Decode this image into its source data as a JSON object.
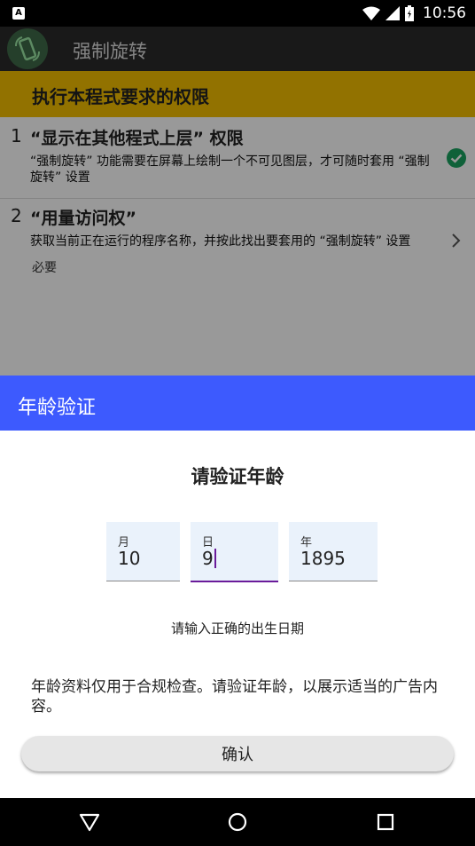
{
  "status_bar": {
    "notification_icon": "A",
    "time": "10:56",
    "icons": [
      "wifi-icon",
      "signal-icon",
      "battery-icon"
    ]
  },
  "app": {
    "title": "强制旋转",
    "banner": "执行本程式要求的权限",
    "permissions": [
      {
        "number": "1",
        "title": "“显示在其他程式上层” 权限",
        "description": "“强制旋转” 功能需要在屏幕上绘制一个不可见图层，才可随时套用 “强制旋转” 设置",
        "sub": "",
        "status_icon": "check-circle-icon"
      },
      {
        "number": "2",
        "title": "“用量访问权”",
        "description": "获取当前正在运行的程序名称，并按此找出要套用的 “强制旋转” 设置",
        "sub": "必要",
        "status_icon": "chevron-right-icon"
      }
    ]
  },
  "dialog": {
    "header_title": "年龄验证",
    "heading": "请验证年龄",
    "fields": {
      "month": {
        "label": "月",
        "value": "10"
      },
      "day": {
        "label": "日",
        "value": "9"
      },
      "year": {
        "label": "年",
        "value": "1895"
      }
    },
    "hint": "请输入正确的出生日期",
    "note": "年龄资料仅用于合规检查。请验证年龄，以展示适当的广告内容。",
    "confirm_label": "确认"
  },
  "colors": {
    "dialog_header": "#3d5afe",
    "banner": "#f4bf00",
    "active_field_underline": "#6a1b9a",
    "check": "#1aa260"
  }
}
